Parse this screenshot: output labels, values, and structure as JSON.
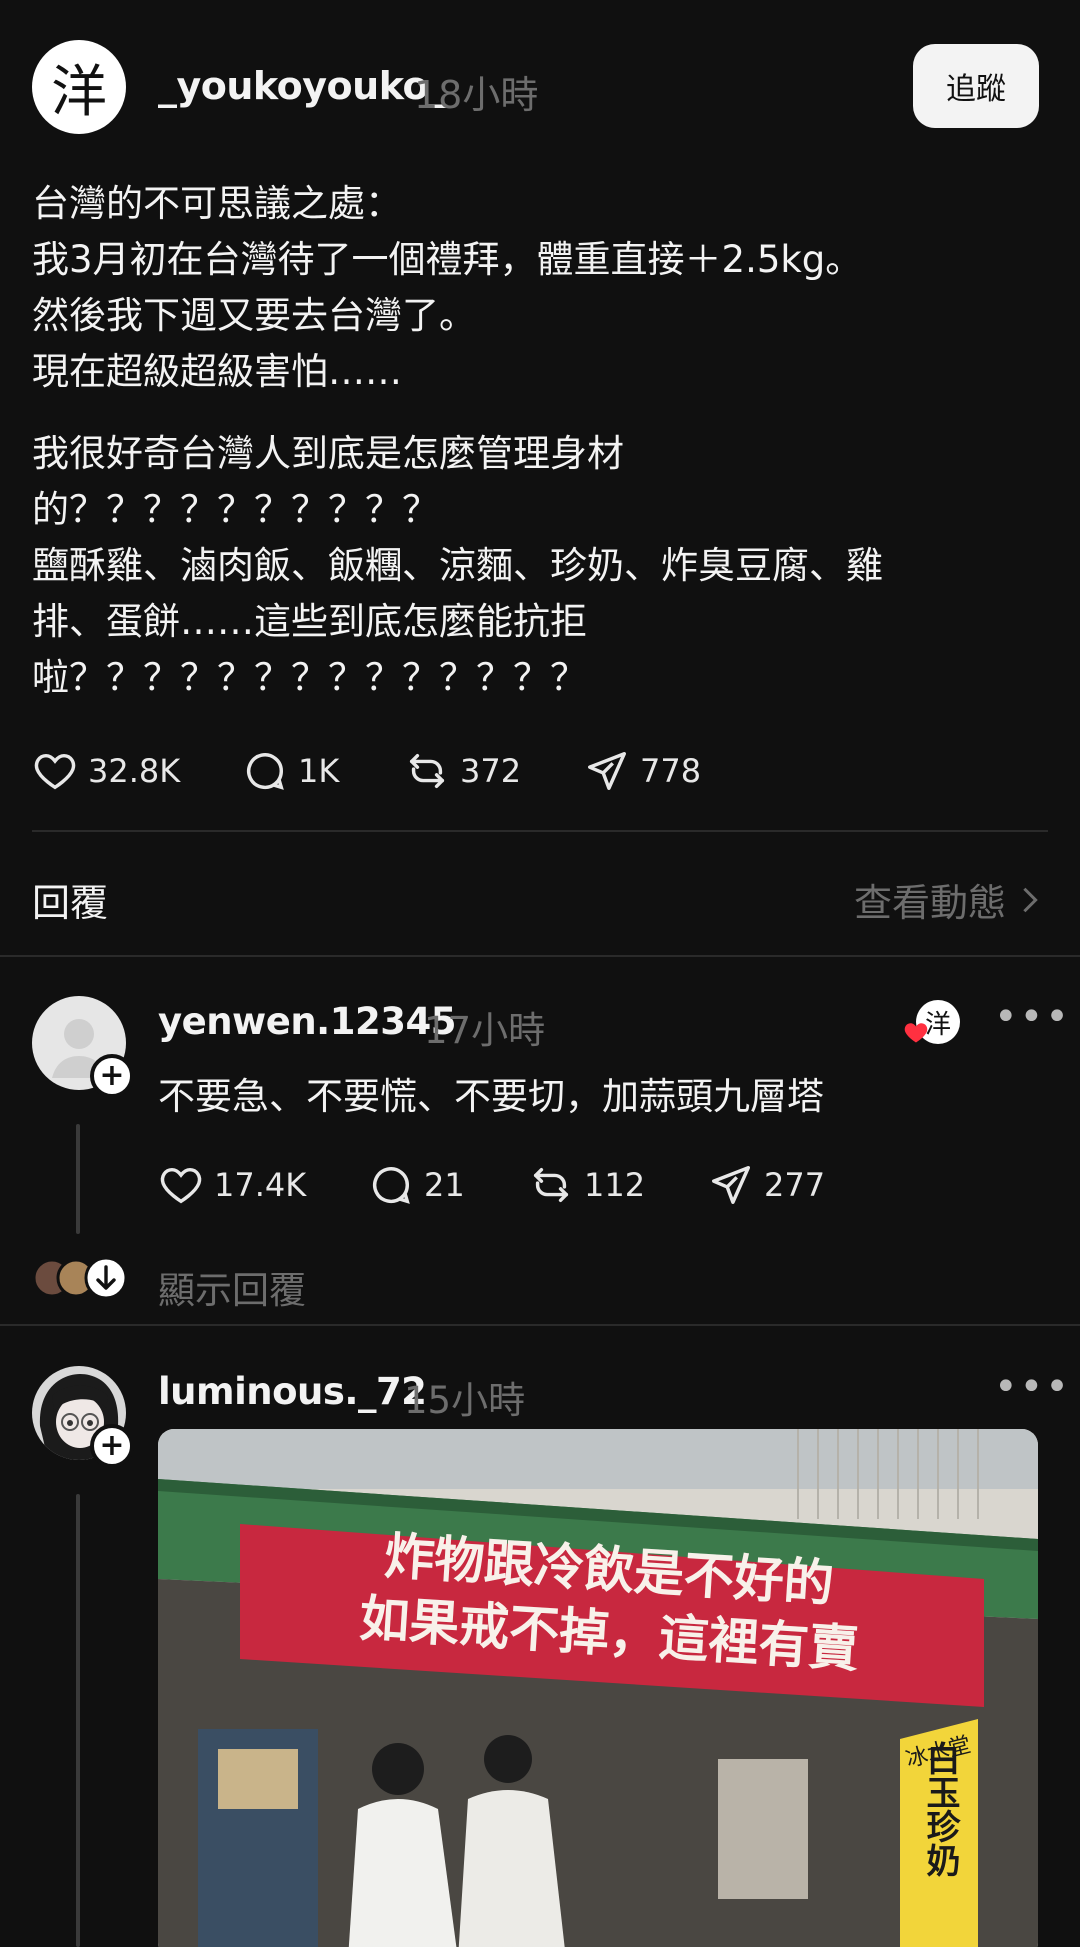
{
  "post": {
    "username": "_youkoyouko_",
    "time": "18小時",
    "avatar_char": "洋",
    "follow_label": "追蹤",
    "paragraph_1": "台灣的不可思議之處：\n我3月初在台灣待了一個禮拜，體重直接＋2.5kg。\n然後我下週又要去台灣了。\n現在超級超級害怕……",
    "paragraph_2": "我很好奇台灣人到底是怎麼管理身材\n的？？？？？？？？？？\n鹽酥雞、滷肉飯、飯糰、涼麵、珍奶、炸臭豆腐、雞\n排、蛋餅……這些到底怎麼能抗拒\n啦？？？？？？？？？？？？？？",
    "likes": "32.8K",
    "comments": "1K",
    "reposts": "372",
    "shares": "778"
  },
  "replies_header": {
    "title": "回覆",
    "view_activity": "查看動態"
  },
  "reply_1": {
    "username": "yenwen.12345",
    "time": "17小時",
    "text": "不要急、不要慌、不要切，加蒜頭九層塔",
    "likes": "17.4K",
    "comments": "21",
    "reposts": "112",
    "shares": "277",
    "liked_by_avatar_char": "洋",
    "show_replies": "顯示回覆"
  },
  "reply_2": {
    "username": "luminous._72",
    "time": "15小時",
    "image_banner_line1": "炸物跟冷飲是不好的",
    "image_banner_line2": "如果戒不掉，這裡有賣",
    "image_sign_line1": "冰水堂",
    "image_sign_line2": "白玉珍奶"
  },
  "icons": {
    "like": "heart-icon",
    "comment": "comment-bubble-icon",
    "repost": "repost-icon",
    "share": "send-icon",
    "more": "more-dots-icon"
  },
  "colors": {
    "background": "#101010",
    "text": "#f3f3f3",
    "muted": "#6d6d6d",
    "divider": "#2a2a2a",
    "heart_red": "#ff3040",
    "banner_red": "#c8283f"
  }
}
